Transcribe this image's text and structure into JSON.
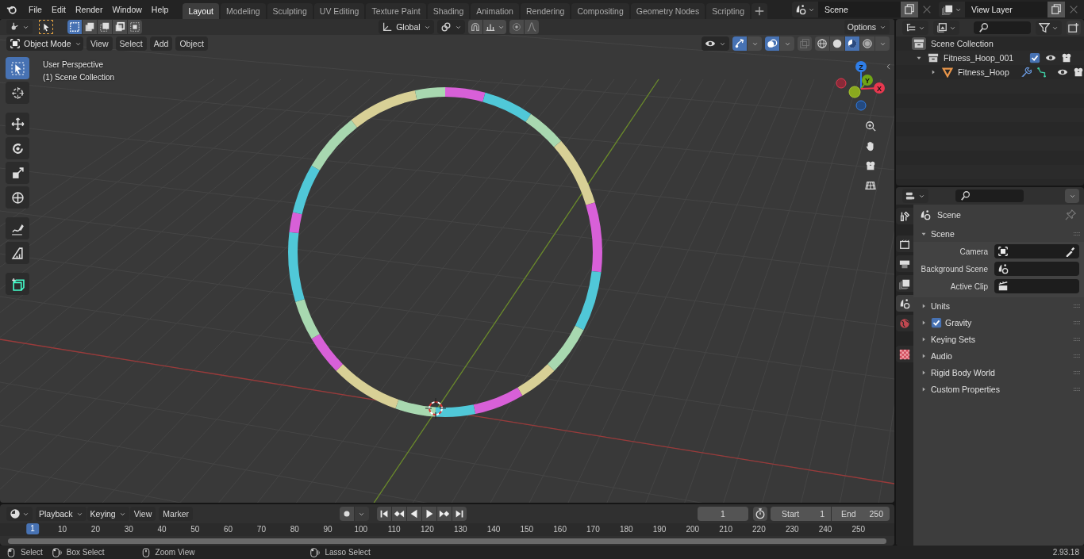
{
  "top_bar": {
    "menus": [
      "File",
      "Edit",
      "Render",
      "Window",
      "Help"
    ],
    "workspaces": [
      {
        "label": "Layout",
        "selected": true
      },
      {
        "label": "Modeling",
        "selected": false
      },
      {
        "label": "Sculpting",
        "selected": false
      },
      {
        "label": "UV Editing",
        "selected": false
      },
      {
        "label": "Texture Paint",
        "selected": false
      },
      {
        "label": "Shading",
        "selected": false
      },
      {
        "label": "Animation",
        "selected": false
      },
      {
        "label": "Rendering",
        "selected": false
      },
      {
        "label": "Compositing",
        "selected": false
      },
      {
        "label": "Geometry Nodes",
        "selected": false
      },
      {
        "label": "Scripting",
        "selected": false
      }
    ],
    "scene": "Scene",
    "view_layer": "View Layer"
  },
  "viewport": {
    "select_modes": [
      {
        "selected": true
      },
      {
        "selected": false
      },
      {
        "selected": false
      },
      {
        "selected": false
      },
      {
        "selected": false
      }
    ],
    "orientation": "Global",
    "options": "Options",
    "mode": "Object Mode",
    "menus": [
      "View",
      "Select",
      "Add",
      "Object"
    ],
    "shading_modes": [
      {
        "selected": false
      },
      {
        "selected": false
      },
      {
        "selected": true
      },
      {
        "selected": false
      }
    ],
    "info": [
      "User Perspective",
      "(1) Scene Collection"
    ],
    "tools": [
      {
        "selected": true
      },
      {
        "selected": false
      },
      {
        "selected": false
      },
      {
        "selected": false
      },
      {
        "selected": false
      },
      {
        "selected": false
      },
      {
        "selected": false
      },
      {
        "selected": false
      },
      {
        "selected": false
      }
    ],
    "gizmo_axes": [
      "Z",
      "Y",
      "X"
    ]
  },
  "outliner": {
    "root": "Scene Collection",
    "items": [
      {
        "label": "Fitness_Hoop_001",
        "expanded": true,
        "checked": true,
        "children": [
          {
            "label": "Fitness_Hoop",
            "expanded": false
          }
        ]
      }
    ]
  },
  "properties": {
    "tabs": [
      {
        "selected": false
      },
      {
        "selected": false
      },
      {
        "selected": false
      },
      {
        "selected": false
      },
      {
        "selected": true
      },
      {
        "selected": false
      },
      {
        "selected": false
      }
    ],
    "title": "Scene",
    "panel": {
      "label": "Scene",
      "expanded": true,
      "fields": [
        "Camera",
        "Background Scene",
        "Active Clip"
      ]
    },
    "sections": [
      {
        "label": "Units",
        "kind": "plain"
      },
      {
        "label": "Gravity",
        "kind": "checkbox",
        "checked": true
      },
      {
        "label": "Keying Sets",
        "kind": "plain"
      },
      {
        "label": "Audio",
        "kind": "plain"
      },
      {
        "label": "Rigid Body World",
        "kind": "plain"
      },
      {
        "label": "Custom Properties",
        "kind": "plain"
      }
    ]
  },
  "timeline": {
    "menus": [
      {
        "label": "Playback",
        "kind": "dropdown"
      },
      {
        "label": "Keying",
        "kind": "dropdown"
      },
      {
        "label": "View",
        "kind": "plain"
      },
      {
        "label": "Marker",
        "kind": "plain"
      }
    ],
    "current_frame": "1",
    "start_label": "Start",
    "start": "1",
    "end_label": "End",
    "end": "250",
    "ruler": [
      {
        "label": "1",
        "selected": true
      },
      {
        "label": "10",
        "selected": false
      },
      {
        "label": "20",
        "selected": false
      },
      {
        "label": "30",
        "selected": false
      },
      {
        "label": "40",
        "selected": false
      },
      {
        "label": "50",
        "selected": false
      },
      {
        "label": "60",
        "selected": false
      },
      {
        "label": "70",
        "selected": false
      },
      {
        "label": "80",
        "selected": false
      },
      {
        "label": "90",
        "selected": false
      },
      {
        "label": "100",
        "selected": false
      },
      {
        "label": "110",
        "selected": false
      },
      {
        "label": "120",
        "selected": false
      },
      {
        "label": "130",
        "selected": false
      },
      {
        "label": "140",
        "selected": false
      },
      {
        "label": "150",
        "selected": false
      },
      {
        "label": "160",
        "selected": false
      },
      {
        "label": "170",
        "selected": false
      },
      {
        "label": "180",
        "selected": false
      },
      {
        "label": "190",
        "selected": false
      },
      {
        "label": "200",
        "selected": false
      },
      {
        "label": "210",
        "selected": false
      },
      {
        "label": "220",
        "selected": false
      },
      {
        "label": "230",
        "selected": false
      },
      {
        "label": "240",
        "selected": false
      },
      {
        "label": "250",
        "selected": false
      }
    ]
  },
  "status_bar": {
    "hints": [
      "Select",
      "Box Select",
      "Zoom View",
      "Lasso Select"
    ],
    "version": "2.93.18"
  }
}
